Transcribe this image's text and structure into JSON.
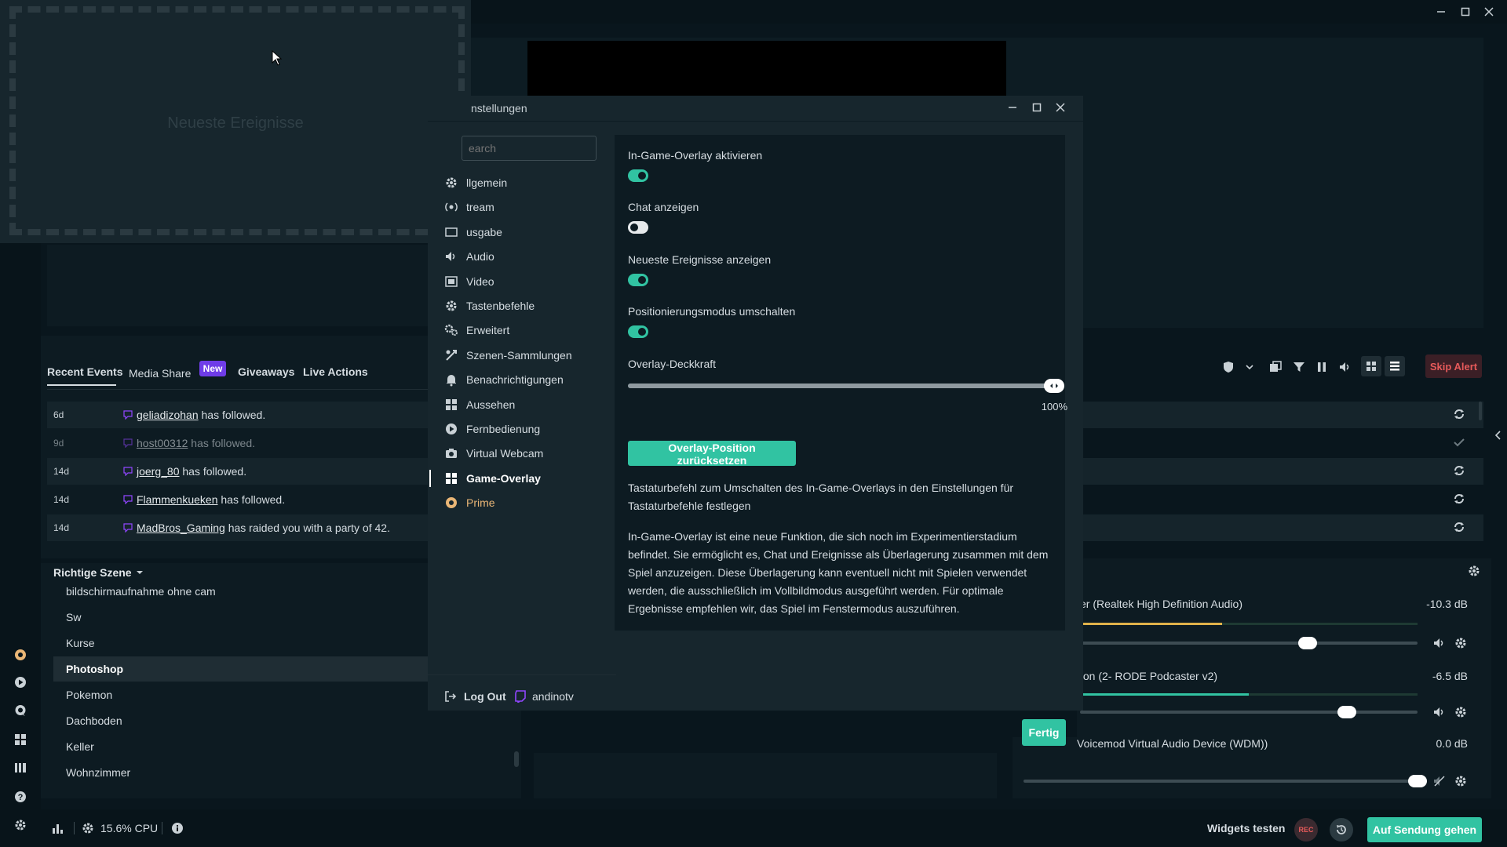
{
  "window": {
    "minimize_icon": "minimize-icon",
    "maximize_icon": "maximize-icon",
    "close_icon": "close-icon"
  },
  "widget": {
    "placeholder": "Neueste Ereignisse"
  },
  "events": {
    "tabs": [
      {
        "label": "Recent Events",
        "active": true
      },
      {
        "label": "Media Share",
        "badge": "New"
      },
      {
        "label": "Giveaways"
      },
      {
        "label": "Live Actions"
      }
    ],
    "rows": [
      {
        "age": "6d",
        "user": "geliadizohan",
        "text": "has followed."
      },
      {
        "age": "9d",
        "user": "host00312",
        "text": "has followed."
      },
      {
        "age": "14d",
        "user": "joerg_80",
        "text": "has followed."
      },
      {
        "age": "14d",
        "user": "Flammenkueken",
        "text": "has followed."
      },
      {
        "age": "14d",
        "user": "MadBros_Gaming",
        "text": "has raided you with a party of 42."
      }
    ],
    "skip_alert": "Skip Alert"
  },
  "scenes": {
    "header": "Richtige Szene",
    "items": [
      "bildschirmaufnahme ohne cam",
      "Sw",
      "Kurse",
      "Photoshop",
      "Pokemon",
      "Dachboden",
      "Keller",
      "Wohnzimmer"
    ],
    "active_index": 3
  },
  "mixer": {
    "sources": [
      {
        "name": "er (Realtek High Definition Audio)",
        "db": "-10.3 dB",
        "level": 0.42
      },
      {
        "name": "fon (2- RODE Podcaster v2)",
        "db": "-6.5 dB",
        "level": 0.5
      },
      {
        "name": "Voicemod Virtual Audio Device (WDM))",
        "db": "0.0 dB",
        "level": 1.0
      }
    ]
  },
  "settings": {
    "title": "nstellungen",
    "search_placeholder": "earch",
    "nav": [
      {
        "label": "llgemein",
        "icon": "gear-icon"
      },
      {
        "label": "tream",
        "icon": "broadcast-icon"
      },
      {
        "label": "usgabe",
        "icon": "output-icon"
      },
      {
        "label": "Audio",
        "icon": "speaker-icon"
      },
      {
        "label": "Video",
        "icon": "film-icon"
      },
      {
        "label": "Tastenbefehle",
        "icon": "keyboard-icon"
      },
      {
        "label": "Erweitert",
        "icon": "cogs-icon"
      },
      {
        "label": "Szenen-Sammlungen",
        "icon": "collection-icon"
      },
      {
        "label": "Benachrichtigungen",
        "icon": "bell-icon"
      },
      {
        "label": "Aussehen",
        "icon": "grid-icon"
      },
      {
        "label": "Fernbedienung",
        "icon": "remote-icon"
      },
      {
        "label": "Virtual Webcam",
        "icon": "camera-icon"
      },
      {
        "label": "Game-Overlay",
        "icon": "overlay-icon"
      },
      {
        "label": "Prime",
        "icon": "prime-icon"
      }
    ],
    "active_nav": "Game-Overlay",
    "options": [
      {
        "label": "In-Game-Overlay aktivieren",
        "on": true
      },
      {
        "label": "Chat anzeigen",
        "on": false
      },
      {
        "label": "Neueste Ereignisse anzeigen",
        "on": true
      },
      {
        "label": "Positionierungsmodus umschalten",
        "on": true
      }
    ],
    "opacity_label": "Overlay-Deckkraft",
    "opacity_value": "100%",
    "opacity": 1.0,
    "reset_button": "Overlay-Position zurücksetzen",
    "hotkey_text": "Tastaturbefehl zum Umschalten des In-Game-Overlays in den Einstellungen für Tastaturbefehle festlegen",
    "info_text": "In-Game-Overlay ist eine neue Funktion, die sich noch im Experimentierstadium befindet. Sie ermöglicht es, Chat und Ereignisse als Überlagerung zusammen mit dem Spiel anzuzeigen. Diese Überlagerung kann eventuell nicht mit Spielen verwendet werden, die ausschließlich im Vollbildmodus ausgeführt werden. Für optimale Ergebnisse empfehlen wir, das Spiel im Fenstermodus auszuführen.",
    "logout": "Log Out",
    "account": "andinotv",
    "done_button": "Fertig"
  },
  "statusbar": {
    "cpu": "15.6% CPU",
    "widgets_test": "Widgets testen",
    "rec": "REC",
    "go_live": "Auf Sendung gehen"
  },
  "colors": {
    "accent": "#31c3a2",
    "new_badge": "#6f3ce8",
    "skip_alert": "#e65a5a",
    "prime": "#eab676",
    "twitch": "#9146ff"
  }
}
